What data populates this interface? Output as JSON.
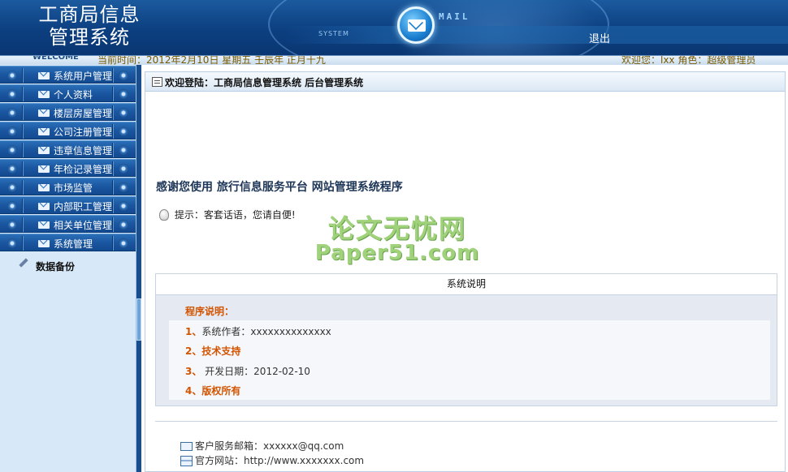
{
  "header": {
    "title_line1": "工商局信息",
    "title_line2": "管理系统",
    "system_label": "SYSTEM",
    "mail_word": "MAIL",
    "logout": "退出"
  },
  "infobar": {
    "welcome": "WELCOME",
    "time_text": "当前时间：2012年2月10日 星期五 壬辰年 正月十九",
    "user_text": "欢迎您：lxx  角色：超级管理员"
  },
  "sidebar": {
    "items": [
      {
        "label": "系统用户管理"
      },
      {
        "label": "个人资料"
      },
      {
        "label": "楼层房屋管理"
      },
      {
        "label": "公司注册管理"
      },
      {
        "label": "违章信息管理"
      },
      {
        "label": "年检记录管理"
      },
      {
        "label": "市场监管"
      },
      {
        "label": "内部职工管理"
      },
      {
        "label": "相关单位管理"
      },
      {
        "label": "系统管理"
      }
    ],
    "sub_item": "数据备份"
  },
  "main": {
    "welcome_bar": "欢迎登陆：工商局信息管理系统 后台管理系统",
    "thanks": "感谢您使用 旅行信息服务平台 网站管理系统程序",
    "tip": "提示：客套话语，您请自便!",
    "watermark_line1": "论文无忧网",
    "watermark_line2": "Paper51.com",
    "desc_header": "系统说明",
    "desc_title": "程序说明：",
    "desc_rows": [
      {
        "num": "1、",
        "label": "系统作者：xxxxxxxxxxxxxx"
      },
      {
        "num": "2、",
        "label": "技术支持"
      },
      {
        "num": "3、",
        "label": " 开发日期：2012-02-10"
      },
      {
        "num": "4、",
        "label": "版权所有"
      }
    ],
    "contact_email": "客户服务邮箱：xxxxxx@qq.com",
    "contact_site": "官方网站：http://www.xxxxxxx.com"
  },
  "colors": {
    "header_blue": "#0c3f80",
    "menu_blue": "#1a56a0",
    "sidebar_bg": "#d7e9f8",
    "accent_orange": "#d35400",
    "watermark_green": "#9fd27a"
  }
}
